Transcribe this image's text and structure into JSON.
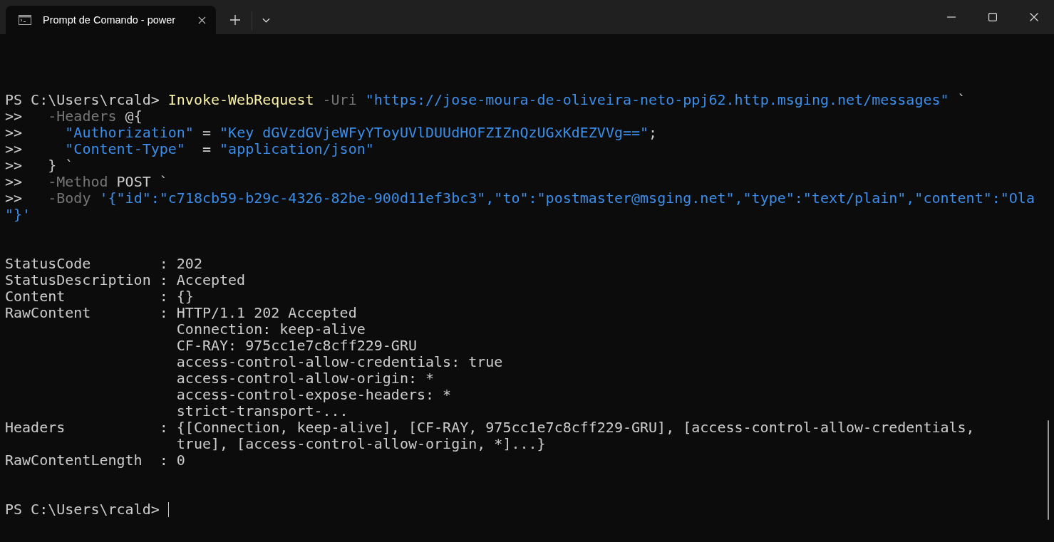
{
  "window": {
    "tabs": [
      {
        "title": "Prompt de Comando - power",
        "selected": true
      }
    ]
  },
  "terminal": {
    "blocks": [
      {
        "lines": [
          [
            {
              "kind": "prompt",
              "text": "PS C:\\Users\\rcald> "
            },
            {
              "kind": "command",
              "text": "Invoke-WebRequest "
            },
            {
              "kind": "param",
              "text": "-Uri "
            },
            {
              "kind": "string",
              "text": "\"https://jose-moura-de-oliveira-neto-ppj62.http.msging.net/messages\""
            },
            {
              "kind": "plain",
              "text": " `"
            }
          ],
          [
            {
              "kind": "prompt",
              "text": ">>   "
            },
            {
              "kind": "param",
              "text": "-Headers"
            },
            {
              "kind": "plain",
              "text": " @{"
            }
          ],
          [
            {
              "kind": "prompt",
              "text": ">>     "
            },
            {
              "kind": "string",
              "text": "\"Authorization\""
            },
            {
              "kind": "plain",
              "text": " = "
            },
            {
              "kind": "string",
              "text": "\"Key dGVzdGVjeWFyYToyUVlDUUdHOFZIZnQzUGxKdEZVVg==\""
            },
            {
              "kind": "plain",
              "text": ";"
            }
          ],
          [
            {
              "kind": "prompt",
              "text": ">>     "
            },
            {
              "kind": "string",
              "text": "\"Content-Type\""
            },
            {
              "kind": "plain",
              "text": "  = "
            },
            {
              "kind": "string",
              "text": "\"application/json\""
            }
          ],
          [
            {
              "kind": "prompt",
              "text": ">>   "
            },
            {
              "kind": "plain",
              "text": "} `"
            }
          ],
          [
            {
              "kind": "prompt",
              "text": ">>   "
            },
            {
              "kind": "param",
              "text": "-Method"
            },
            {
              "kind": "plain",
              "text": " POST `"
            }
          ],
          [
            {
              "kind": "prompt",
              "text": ">>   "
            },
            {
              "kind": "param",
              "text": "-Body "
            },
            {
              "kind": "string",
              "text": "'{\"id\":\"c718cb59-b29c-4326-82be-900d11ef3bc3\",\"to\":\"postmaster@msging.net\",\"type\":\"text/plain\",\"content\":\"Ola"
            }
          ],
          [
            {
              "kind": "string",
              "text": "\"}'"
            }
          ]
        ]
      },
      {
        "lines": [
          [
            {
              "kind": "plain",
              "text": "StatusCode        : 202"
            }
          ],
          [
            {
              "kind": "plain",
              "text": "StatusDescription : Accepted"
            }
          ],
          [
            {
              "kind": "plain",
              "text": "Content           : {}"
            }
          ],
          [
            {
              "kind": "plain",
              "text": "RawContent        : HTTP/1.1 202 Accepted"
            }
          ],
          [
            {
              "kind": "plain",
              "text": "                    Connection: keep-alive"
            }
          ],
          [
            {
              "kind": "plain",
              "text": "                    CF-RAY: 975cc1e7c8cff229-GRU"
            }
          ],
          [
            {
              "kind": "plain",
              "text": "                    access-control-allow-credentials: true"
            }
          ],
          [
            {
              "kind": "plain",
              "text": "                    access-control-allow-origin: *"
            }
          ],
          [
            {
              "kind": "plain",
              "text": "                    access-control-expose-headers: *"
            }
          ],
          [
            {
              "kind": "plain",
              "text": "                    strict-transport-..."
            }
          ],
          [
            {
              "kind": "plain",
              "text": "Headers           : {[Connection, keep-alive], [CF-RAY, 975cc1e7c8cff229-GRU], [access-control-allow-credentials,"
            }
          ],
          [
            {
              "kind": "plain",
              "text": "                    true], [access-control-allow-origin, *]...}"
            }
          ],
          [
            {
              "kind": "plain",
              "text": "RawContentLength  : 0"
            }
          ]
        ]
      },
      {
        "lines": [
          [
            {
              "kind": "prompt",
              "text": "PS C:\\Users\\rcald> "
            }
          ]
        ],
        "cursor": true
      }
    ]
  }
}
